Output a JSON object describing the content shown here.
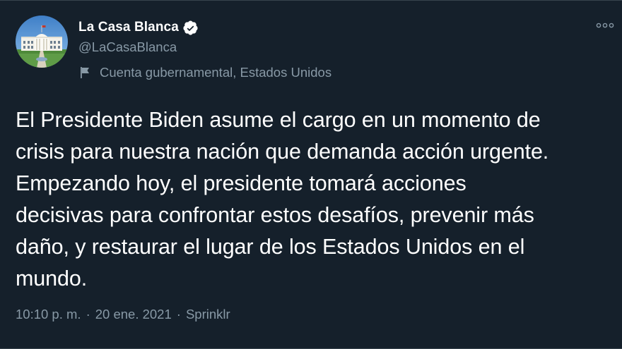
{
  "account": {
    "display_name": "La Casa Blanca",
    "handle": "@LaCasaBlanca",
    "label": "Cuenta gubernamental, Estados Unidos",
    "avatar": "white-house-avatar",
    "verified_icon": "verified-badge-icon"
  },
  "tweet": {
    "lines": [
      "El Presidente Biden asume el cargo en un momento de",
      "crisis para nuestra nación que demanda acción urgente.",
      "Empezando hoy, el presidente tomará acciones",
      "decisivas para confrontar estos desafíos, prevenir más",
      "daño, y restaurar el lugar de los Estados Unidos en el",
      "mundo."
    ]
  },
  "meta": {
    "time": "10:10 p. m.",
    "separator": "·",
    "date": "20 ene. 2021",
    "source": "Sprinklr"
  },
  "colors": {
    "background": "#15202b",
    "text": "#ffffff",
    "secondary": "#8899a6",
    "divider": "#38444d"
  }
}
